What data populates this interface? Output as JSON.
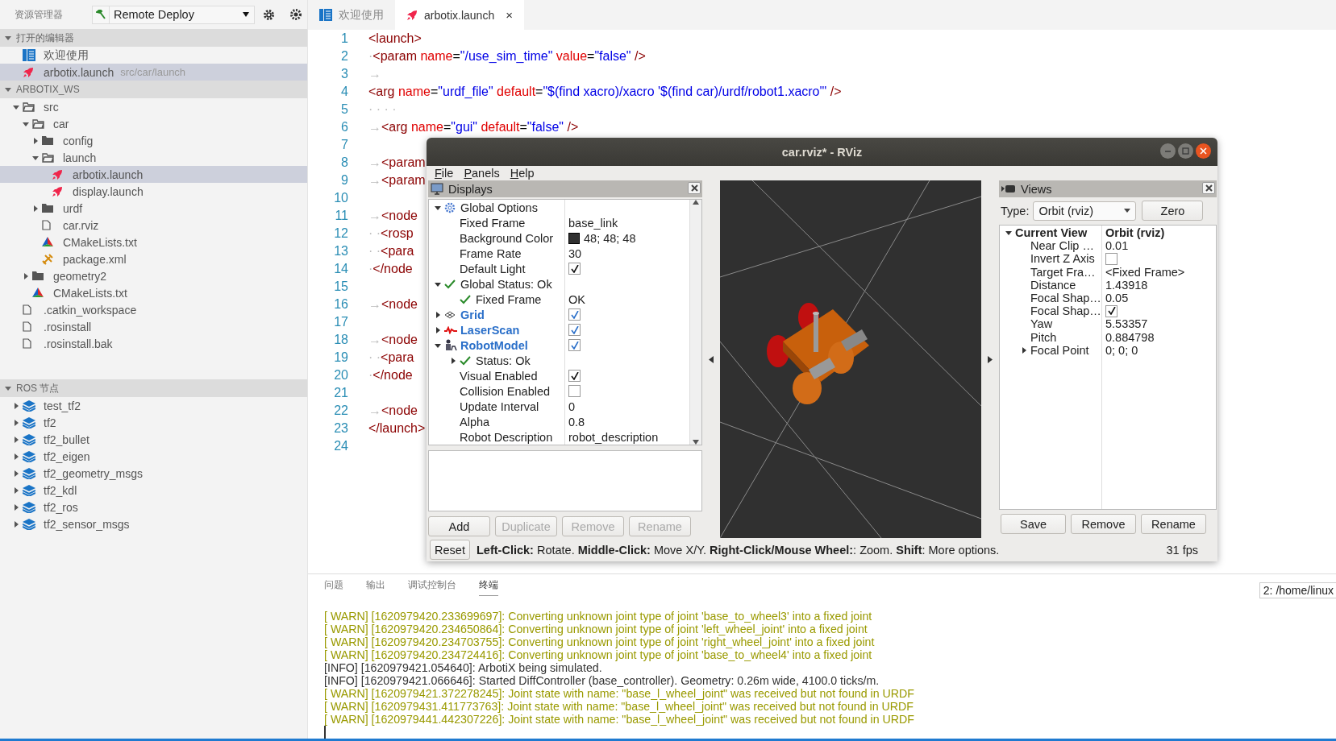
{
  "sidebar": {
    "title": "资源管理器",
    "deploy": {
      "value": "Remote Deploy"
    },
    "sections": [
      {
        "title": "打开的编辑器",
        "expanded": true,
        "items": [
          {
            "kind": "welcome",
            "label": "欢迎使用",
            "selected": false
          },
          {
            "kind": "launch",
            "label": "arbotix.launch",
            "path": "src/car/launch",
            "selected": true
          }
        ]
      },
      {
        "title": "ARBOTIX_WS",
        "expanded": true,
        "items": [
          {
            "kind": "folder",
            "label": "src",
            "expanded": true,
            "selected": false,
            "children": [
              {
                "kind": "folder",
                "label": "car",
                "expanded": true,
                "selected": false,
                "children": [
                  {
                    "kind": "folder",
                    "label": "config",
                    "expanded": false,
                    "selected": false
                  },
                  {
                    "kind": "folder",
                    "label": "launch",
                    "expanded": true,
                    "selected": false,
                    "children": [
                      {
                        "kind": "launch",
                        "label": "arbotix.launch",
                        "selected": true
                      },
                      {
                        "kind": "launch",
                        "label": "display.launch",
                        "selected": false
                      }
                    ]
                  },
                  {
                    "kind": "folder",
                    "label": "urdf",
                    "expanded": false,
                    "selected": false
                  },
                  {
                    "kind": "file",
                    "label": "car.rviz",
                    "selected": false
                  },
                  {
                    "kind": "cmake",
                    "label": "CMakeLists.txt",
                    "selected": false
                  },
                  {
                    "kind": "xml",
                    "label": "package.xml",
                    "selected": false
                  }
                ]
              },
              {
                "kind": "folder",
                "label": "geometry2",
                "expanded": false,
                "selected": false
              },
              {
                "kind": "cmake",
                "label": "CMakeLists.txt",
                "selected": false
              }
            ]
          },
          {
            "kind": "file",
            "label": ".catkin_workspace",
            "selected": false
          },
          {
            "kind": "file",
            "label": ".rosinstall",
            "selected": false
          },
          {
            "kind": "file",
            "label": ".rosinstall.bak",
            "selected": false
          }
        ]
      },
      {
        "title": "ROS 节点",
        "expanded": true,
        "items": [
          {
            "kind": "package",
            "label": "test_tf2",
            "expanded": false,
            "selected": false
          },
          {
            "kind": "package",
            "label": "tf2",
            "expanded": false,
            "selected": false
          },
          {
            "kind": "package",
            "label": "tf2_bullet",
            "expanded": false,
            "selected": false
          },
          {
            "kind": "package",
            "label": "tf2_eigen",
            "expanded": false,
            "selected": false
          },
          {
            "kind": "package",
            "label": "tf2_geometry_msgs",
            "expanded": false,
            "selected": false
          },
          {
            "kind": "package",
            "label": "tf2_kdl",
            "expanded": false,
            "selected": false
          },
          {
            "kind": "package",
            "label": "tf2_ros",
            "expanded": false,
            "selected": false
          },
          {
            "kind": "package",
            "label": "tf2_sensor_msgs",
            "expanded": false,
            "selected": false
          }
        ]
      }
    ]
  },
  "editor": {
    "tabs": [
      {
        "kind": "welcome",
        "label": "欢迎使用",
        "selected": false
      },
      {
        "kind": "launch",
        "label": "arbotix.launch",
        "selected": true,
        "close": "×"
      }
    ],
    "lines": [
      {
        "number": "1",
        "tokens": [
          {
            "kind": "tag",
            "text": "<launch>"
          }
        ]
      },
      {
        "number": "2",
        "tokens": [
          {
            "kind": "ws",
            "text": "·"
          },
          {
            "kind": "tag",
            "text": "<param "
          },
          {
            "kind": "attr",
            "text": "name"
          },
          {
            "kind": "eq",
            "text": "="
          },
          {
            "kind": "str",
            "text": "\"/use_sim_time\" "
          },
          {
            "kind": "attr",
            "text": "value"
          },
          {
            "kind": "eq",
            "text": "="
          },
          {
            "kind": "str",
            "text": "\"false\" "
          },
          {
            "kind": "tag",
            "text": "/>"
          }
        ]
      },
      {
        "number": "3",
        "tokens": [
          {
            "kind": "ws",
            "text": "→"
          }
        ]
      },
      {
        "number": "4",
        "tokens": [
          {
            "kind": "tag",
            "text": "<arg "
          },
          {
            "kind": "attr",
            "text": "name"
          },
          {
            "kind": "eq",
            "text": "="
          },
          {
            "kind": "str",
            "text": "\"urdf_file\" "
          },
          {
            "kind": "attr",
            "text": "default"
          },
          {
            "kind": "eq",
            "text": "="
          },
          {
            "kind": "str",
            "text": "\"$(find xacro)/xacro '$(find car)/urdf/robot1.xacro'\" "
          },
          {
            "kind": "tag",
            "text": "/>"
          }
        ]
      },
      {
        "number": "5",
        "tokens": [
          {
            "kind": "ws",
            "text": "· · · ·"
          }
        ]
      },
      {
        "number": "6",
        "tokens": [
          {
            "kind": "ws",
            "text": "→"
          },
          {
            "kind": "tag",
            "text": "<arg "
          },
          {
            "kind": "attr",
            "text": "name"
          },
          {
            "kind": "eq",
            "text": "="
          },
          {
            "kind": "str",
            "text": "\"gui\" "
          },
          {
            "kind": "attr",
            "text": "default"
          },
          {
            "kind": "eq",
            "text": "="
          },
          {
            "kind": "str",
            "text": "\"false\" "
          },
          {
            "kind": "tag",
            "text": "/>"
          }
        ]
      },
      {
        "number": "7"
      },
      {
        "number": "8",
        "tokens": [
          {
            "kind": "ws",
            "text": "→"
          },
          {
            "kind": "tag",
            "text": "<param"
          }
        ]
      },
      {
        "number": "9",
        "tokens": [
          {
            "kind": "ws",
            "text": "→"
          },
          {
            "kind": "tag",
            "text": "<param"
          }
        ]
      },
      {
        "number": "10"
      },
      {
        "number": "11",
        "tokens": [
          {
            "kind": "ws",
            "text": "→"
          },
          {
            "kind": "tag",
            "text": "<node"
          }
        ]
      },
      {
        "number": "12",
        "tokens": [
          {
            "kind": "ws",
            "text": "· ·"
          },
          {
            "kind": "tag",
            "text": "<rosp"
          }
        ]
      },
      {
        "number": "13",
        "tokens": [
          {
            "kind": "ws",
            "text": "· ·"
          },
          {
            "kind": "tag",
            "text": "<para"
          }
        ]
      },
      {
        "number": "14",
        "tokens": [
          {
            "kind": "ws",
            "text": "·"
          },
          {
            "kind": "tag",
            "text": "</node"
          }
        ]
      },
      {
        "number": "15"
      },
      {
        "number": "16",
        "tokens": [
          {
            "kind": "ws",
            "text": "→"
          },
          {
            "kind": "tag",
            "text": "<node"
          }
        ]
      },
      {
        "number": "17"
      },
      {
        "number": "18",
        "tokens": [
          {
            "kind": "ws",
            "text": "→"
          },
          {
            "kind": "tag",
            "text": "<node"
          }
        ]
      },
      {
        "number": "19",
        "tokens": [
          {
            "kind": "ws",
            "text": "· ·"
          },
          {
            "kind": "tag",
            "text": "<para"
          }
        ]
      },
      {
        "number": "20",
        "tokens": [
          {
            "kind": "ws",
            "text": "·"
          },
          {
            "kind": "tag",
            "text": "</node"
          }
        ]
      },
      {
        "number": "21"
      },
      {
        "number": "22",
        "tokens": [
          {
            "kind": "ws",
            "text": "→"
          },
          {
            "kind": "tag",
            "text": "<node"
          }
        ]
      },
      {
        "number": "23",
        "tokens": [
          {
            "kind": "tag",
            "text": "</launch>"
          }
        ]
      },
      {
        "number": "24"
      }
    ]
  },
  "rviz": {
    "title": "car.rviz* - RViz",
    "menu": [
      "File",
      "Panels",
      "Help"
    ],
    "displays": {
      "title": "Displays",
      "rows": [
        {
          "kind": "options",
          "label": "Global Options",
          "expanded": true,
          "children": [
            {
              "kind": "property",
              "label": "Fixed Frame",
              "value": "base_link"
            },
            {
              "kind": "property",
              "label": "Background Color",
              "value": "48; 48; 48",
              "color": "#303030"
            },
            {
              "kind": "property",
              "label": "Frame Rate",
              "value": "30"
            },
            {
              "kind": "property",
              "label": "Default Light",
              "checked": true
            }
          ]
        },
        {
          "kind": "status",
          "label": "Global Status: Ok",
          "expanded": true,
          "children": [
            {
              "kind": "status",
              "label": "Fixed Frame",
              "value": "OK"
            }
          ]
        },
        {
          "kind": "grid",
          "label": "Grid",
          "expanded": false,
          "checked": true
        },
        {
          "kind": "laserscan",
          "label": "LaserScan",
          "expanded": false,
          "checked": true
        },
        {
          "kind": "robotmodel",
          "label": "RobotModel",
          "expanded": true,
          "checked": true,
          "children": [
            {
              "kind": "status",
              "label": "Status: Ok",
              "expanded": false
            },
            {
              "kind": "property",
              "label": "Visual Enabled",
              "checked": true
            },
            {
              "kind": "property",
              "label": "Collision Enabled",
              "checked": false
            },
            {
              "kind": "property",
              "label": "Update Interval",
              "value": "0"
            },
            {
              "kind": "property",
              "label": "Alpha",
              "value": "0.8"
            },
            {
              "kind": "property",
              "label": "Robot Description",
              "value": "robot_description"
            }
          ]
        }
      ],
      "buttons": [
        {
          "label": "Add",
          "disabled": false
        },
        {
          "label": "Duplicate",
          "disabled": true
        },
        {
          "label": "Remove",
          "disabled": true
        },
        {
          "label": "Rename",
          "disabled": true
        }
      ]
    },
    "views": {
      "title": "Views",
      "type_label": "Type:",
      "type_value": "Orbit (rviz)",
      "zero": "Zero",
      "rows": [
        {
          "kind": "header",
          "label": "Current View",
          "value": "Orbit (rviz)",
          "expanded": true,
          "children": [
            {
              "kind": "property",
              "label": "Near Clip …",
              "value": "0.01"
            },
            {
              "kind": "property",
              "label": "Invert Z Axis",
              "checked": false
            },
            {
              "kind": "property",
              "label": "Target Fra…",
              "value": "<Fixed Frame>"
            },
            {
              "kind": "property",
              "label": "Distance",
              "value": "1.43918"
            },
            {
              "kind": "property",
              "label": "Focal Shap…",
              "value": "0.05"
            },
            {
              "kind": "property",
              "label": "Focal Shap…",
              "checked": true
            },
            {
              "kind": "property",
              "label": "Yaw",
              "value": "5.53357"
            },
            {
              "kind": "property",
              "label": "Pitch",
              "value": "0.884798"
            },
            {
              "kind": "property",
              "label": "Focal Point",
              "value": "0; 0; 0",
              "expanded": false
            }
          ]
        }
      ],
      "buttons": [
        "Save",
        "Remove",
        "Rename"
      ]
    },
    "reset": "Reset",
    "hint": "**Left-Click:** Rotate. **Middle-Click:** Move X/Y. **Right-Click/Mouse Wheel:**: Zoom. **Shift**: More options.",
    "fps": "31 fps"
  },
  "panel": {
    "tabs": [
      {
        "label": "问题",
        "selected": false
      },
      {
        "label": "输出",
        "selected": false
      },
      {
        "label": "调试控制台",
        "selected": false
      },
      {
        "label": "终端",
        "selected": true
      }
    ],
    "terminal_select": "2: /home/linux",
    "lines": [
      {
        "kind": "warn",
        "text": "[ WARN] [1620979420.233699697]: Converting unknown joint type of joint 'base_to_wheel3' into a fixed joint"
      },
      {
        "kind": "warn",
        "text": "[ WARN] [1620979420.234650864]: Converting unknown joint type of joint 'left_wheel_joint' into a fixed joint"
      },
      {
        "kind": "warn",
        "text": "[ WARN] [1620979420.234703755]: Converting unknown joint type of joint 'right_wheel_joint' into a fixed joint"
      },
      {
        "kind": "warn",
        "text": "[ WARN] [1620979420.234724416]: Converting unknown joint type of joint 'base_to_wheel4' into a fixed joint"
      },
      {
        "kind": "info",
        "text": "[INFO] [1620979421.054640]: ArbotiX being simulated."
      },
      {
        "kind": "info",
        "text": "[INFO] [1620979421.066646]: Started DiffController (base_controller). Geometry: 0.26m wide, 4100.0 ticks/m."
      },
      {
        "kind": "warn",
        "text": "[ WARN] [1620979421.372278245]: Joint state with name: \"base_l_wheel_joint\" was received but not found in URDF"
      },
      {
        "kind": "warn",
        "text": "[ WARN] [1620979431.411773763]: Joint state with name: \"base_l_wheel_joint\" was received but not found in URDF"
      },
      {
        "kind": "warn",
        "text": "[ WARN] [1620979441.442307226]: Joint state with name: \"base_l_wheel_joint\" was received but not found in URDF"
      }
    ]
  }
}
